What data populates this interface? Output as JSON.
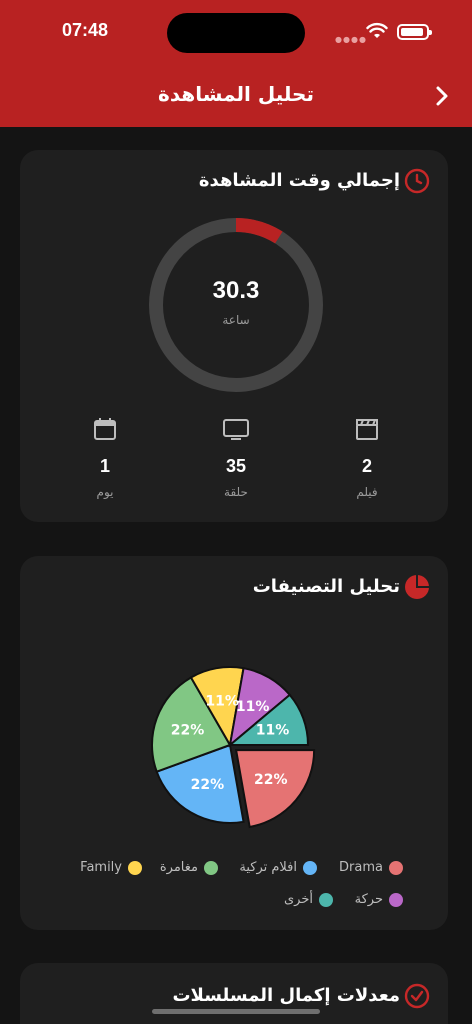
{
  "status": {
    "time": "07:48"
  },
  "nav": {
    "title": "تحليل المشاهدة"
  },
  "watch_time": {
    "title": "إجمالي وقت المشاهدة",
    "total": "30.3",
    "unit": "ساعة",
    "progress_fraction": 0.09,
    "stats": [
      {
        "icon": "calendar-icon",
        "value": "1",
        "label": "يوم"
      },
      {
        "icon": "tv-icon",
        "value": "35",
        "label": "حلقة"
      },
      {
        "icon": "clapperboard-icon",
        "value": "2",
        "label": "فيلم"
      }
    ]
  },
  "genres": {
    "title": "تحليل التصنيفات",
    "legend": [
      {
        "label": "Drama",
        "color": "#e57373"
      },
      {
        "label": "افلام تركية",
        "color": "#64b5f6"
      },
      {
        "label": "مغامرة",
        "color": "#81c784"
      },
      {
        "label": "Family",
        "color": "#ffd54f"
      },
      {
        "label": "حركة",
        "color": "#ba68c8"
      },
      {
        "label": "أخرى",
        "color": "#4db6ac"
      }
    ]
  },
  "chart_data": {
    "type": "pie",
    "categories": [
      "Drama",
      "افلام تركية",
      "مغامرة",
      "Family",
      "حركة",
      "أخرى"
    ],
    "values": [
      22,
      22,
      22,
      11,
      11,
      11
    ],
    "labels": [
      "22%",
      "22%",
      "22%",
      "11%",
      "11%",
      "11%"
    ],
    "colors": [
      "#e57373",
      "#64b5f6",
      "#81c784",
      "#ffd54f",
      "#ba68c8",
      "#4db6ac"
    ],
    "highlight_index": 0
  },
  "completion": {
    "title": "معدلات إكمال المسلسلات"
  }
}
